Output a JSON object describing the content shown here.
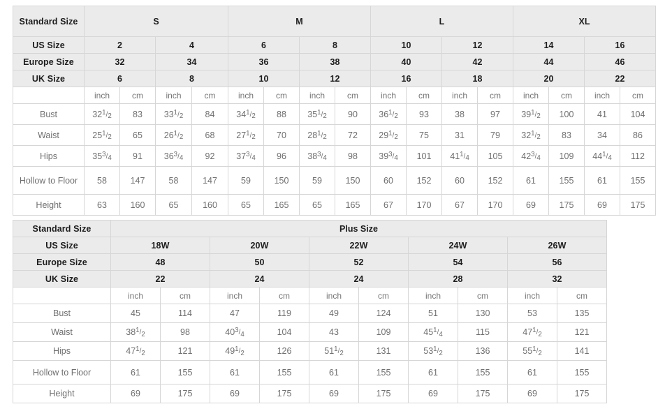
{
  "standard_table": {
    "corner_label": "Standard Size",
    "row_labels": {
      "us": "US Size",
      "europe": "Europe Size",
      "uk": "UK Size",
      "bust": "Bust",
      "waist": "Waist",
      "hips": "Hips",
      "hollow": "Hollow to Floor",
      "height": "Height"
    },
    "unit_inch": "inch",
    "unit_cm": "cm",
    "groups": [
      {
        "label": "S",
        "span": 4
      },
      {
        "label": "M",
        "span": 4
      },
      {
        "label": "L",
        "span": 4
      },
      {
        "label": "XL",
        "span": 4
      }
    ],
    "us_sizes": [
      "2",
      "4",
      "6",
      "8",
      "10",
      "12",
      "14",
      "16"
    ],
    "europe_sizes": [
      "32",
      "34",
      "36",
      "38",
      "40",
      "42",
      "44",
      "46"
    ],
    "uk_sizes": [
      "6",
      "8",
      "10",
      "12",
      "16",
      "18",
      "20",
      "22"
    ],
    "measurements": [
      {
        "label": "Bust",
        "inch": [
          "32 1/2",
          "33 1/2",
          "34 1/2",
          "35 1/2",
          "36 1/2",
          "38",
          "39 1/2",
          "41"
        ],
        "cm": [
          "83",
          "84",
          "88",
          "90",
          "93",
          "97",
          "100",
          "104"
        ]
      },
      {
        "label": "Waist",
        "inch": [
          "25 1/2",
          "26 1/2",
          "27 1/2",
          "28 1/2",
          "29 1/2",
          "31",
          "32 1/2",
          "34"
        ],
        "cm": [
          "65",
          "68",
          "70",
          "72",
          "75",
          "79",
          "83",
          "86"
        ]
      },
      {
        "label": "Hips",
        "inch": [
          "35 3/4",
          "36 3/4",
          "37 3/4",
          "38 3/4",
          "39 3/4",
          "41 1/4",
          "42 3/4",
          "44 1/4"
        ],
        "cm": [
          "91",
          "92",
          "96",
          "98",
          "101",
          "105",
          "109",
          "112"
        ]
      },
      {
        "label": "Hollow to Floor",
        "inch": [
          "58",
          "58",
          "59",
          "59",
          "60",
          "60",
          "61",
          "61"
        ],
        "cm": [
          "147",
          "147",
          "150",
          "150",
          "152",
          "152",
          "155",
          "155"
        ]
      },
      {
        "label": "Height",
        "inch": [
          "63",
          "65",
          "65",
          "65",
          "67",
          "67",
          "69",
          "69"
        ],
        "cm": [
          "160",
          "160",
          "165",
          "165",
          "170",
          "170",
          "175",
          "175"
        ]
      }
    ]
  },
  "plus_table": {
    "corner_label": "Standard Size",
    "group_title": "Plus Size",
    "row_labels": {
      "us": "US Size",
      "europe": "Europe Size",
      "uk": "UK Size"
    },
    "unit_inch": "inch",
    "unit_cm": "cm",
    "us_sizes": [
      "18W",
      "20W",
      "22W",
      "24W",
      "26W"
    ],
    "europe_sizes": [
      "48",
      "50",
      "52",
      "54",
      "56"
    ],
    "uk_sizes": [
      "22",
      "24",
      "24",
      "28",
      "32"
    ],
    "measurements": [
      {
        "label": "Bust",
        "inch": [
          "45",
          "47",
          "49",
          "51",
          "53"
        ],
        "cm": [
          "114",
          "119",
          "124",
          "130",
          "135"
        ]
      },
      {
        "label": "Waist",
        "inch": [
          "38 1/2",
          "40 3/4",
          "43",
          "45 1/4",
          "47 1/2"
        ],
        "cm": [
          "98",
          "104",
          "109",
          "115",
          "121"
        ]
      },
      {
        "label": "Hips",
        "inch": [
          "47 1/2",
          "49 1/2",
          "51 1/2",
          "53 1/2",
          "55 1/2"
        ],
        "cm": [
          "121",
          "126",
          "131",
          "136",
          "141"
        ]
      },
      {
        "label": "Hollow to Floor",
        "inch": [
          "61",
          "61",
          "61",
          "61",
          "61"
        ],
        "cm": [
          "155",
          "155",
          "155",
          "155",
          "155"
        ]
      },
      {
        "label": "Height",
        "inch": [
          "69",
          "69",
          "69",
          "69",
          "69"
        ],
        "cm": [
          "175",
          "175",
          "175",
          "175",
          "175"
        ]
      }
    ]
  },
  "colors": {
    "header_bg": "#ebebeb",
    "cell_bg": "#ffffff",
    "border": "#d6d6d6",
    "header_text": "#1d1d1d",
    "cell_text": "#6f6f6f"
  }
}
